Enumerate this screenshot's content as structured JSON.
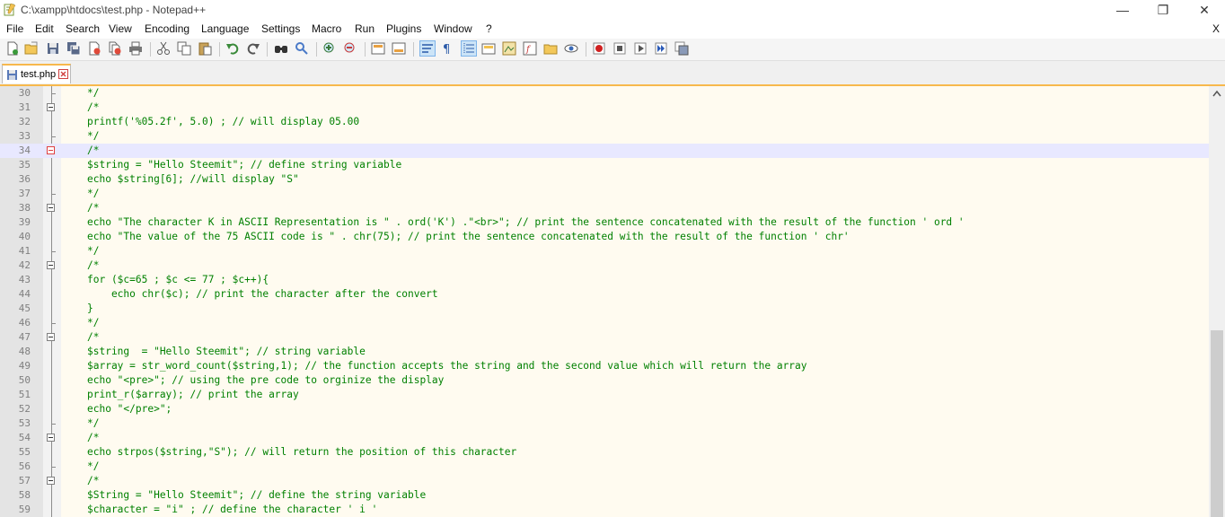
{
  "window": {
    "title": "C:\\xampp\\htdocs\\test.php - Notepad++",
    "minimize": "—",
    "restore": "❐",
    "close": "✕"
  },
  "menu": {
    "items": [
      "File",
      "Edit",
      "Search",
      "View",
      "Encoding",
      "Language",
      "Settings",
      "Macro",
      "Run",
      "Plugins",
      "Window",
      "?"
    ],
    "close_label": "X"
  },
  "toolbar": {
    "icons": [
      "new-file-icon",
      "open-file-icon",
      "save-icon",
      "save-all-icon",
      "close-icon",
      "close-all-icon",
      "print-icon",
      "cut-icon",
      "copy-icon",
      "paste-icon",
      "undo-icon",
      "redo-icon",
      "find-icon",
      "replace-icon",
      "zoom-in-icon",
      "zoom-out-icon",
      "sync-vertical-icon",
      "sync-horizontal-icon",
      "word-wrap-icon",
      "show-all-characters-icon",
      "indent-guide-icon",
      "user-language-icon",
      "document-map-icon",
      "function-list-icon",
      "folder-workspace-icon",
      "monitoring-icon",
      "record-macro-icon",
      "stop-macro-icon",
      "play-macro-icon",
      "run-macro-multiple-icon",
      "save-macro-icon"
    ]
  },
  "tabs": [
    {
      "label": "test.php"
    }
  ],
  "editor": {
    "lines": [
      {
        "n": "30",
        "code": "*/",
        "fold": "end"
      },
      {
        "n": "31",
        "code": "/*",
        "fold": "box"
      },
      {
        "n": "32",
        "code": "printf('%05.2f', 5.0) ; // will display 05.00",
        "fold": ""
      },
      {
        "n": "33",
        "code": "*/",
        "fold": "end"
      },
      {
        "n": "34",
        "code": "/*",
        "fold": "box-red",
        "current": true
      },
      {
        "n": "35",
        "code": "$string = \"Hello Steemit\"; // define string variable",
        "fold": ""
      },
      {
        "n": "36",
        "code": "echo $string[6]; //will display \"S\"",
        "fold": ""
      },
      {
        "n": "37",
        "code": "*/",
        "fold": "end"
      },
      {
        "n": "38",
        "code": "/*",
        "fold": "box"
      },
      {
        "n": "39",
        "code": "echo \"The character K in ASCII Representation is \" . ord('K') .\"<br>\"; // print the sentence concatenated with the result of the function ' ord '",
        "fold": ""
      },
      {
        "n": "40",
        "code": "echo \"The value of the 75 ASCII code is \" . chr(75); // print the sentence concatenated with the result of the function ' chr'",
        "fold": ""
      },
      {
        "n": "41",
        "code": "*/",
        "fold": "end"
      },
      {
        "n": "42",
        "code": "/*",
        "fold": "box"
      },
      {
        "n": "43",
        "code": "for ($c=65 ; $c <= 77 ; $c++){",
        "fold": ""
      },
      {
        "n": "44",
        "code": "    echo chr($c); // print the character after the convert",
        "fold": ""
      },
      {
        "n": "45",
        "code": "}",
        "fold": ""
      },
      {
        "n": "46",
        "code": "*/",
        "fold": "end"
      },
      {
        "n": "47",
        "code": "/*",
        "fold": "box"
      },
      {
        "n": "48",
        "code": "$string  = \"Hello Steemit\"; // string variable",
        "fold": ""
      },
      {
        "n": "49",
        "code": "$array = str_word_count($string,1); // the function accepts the string and the second value which will return the array",
        "fold": ""
      },
      {
        "n": "50",
        "code": "echo \"<pre>\"; // using the pre code to orginize the display",
        "fold": ""
      },
      {
        "n": "51",
        "code": "print_r($array); // print the array",
        "fold": ""
      },
      {
        "n": "52",
        "code": "echo \"</pre>\";",
        "fold": ""
      },
      {
        "n": "53",
        "code": "*/",
        "fold": "end"
      },
      {
        "n": "54",
        "code": "/*",
        "fold": "box"
      },
      {
        "n": "55",
        "code": "echo strpos($string,\"S\"); // will return the position of this character",
        "fold": ""
      },
      {
        "n": "56",
        "code": "*/",
        "fold": "end"
      },
      {
        "n": "57",
        "code": "/*",
        "fold": "box"
      },
      {
        "n": "58",
        "code": "$String = \"Hello Steemit\"; // define the string variable",
        "fold": ""
      },
      {
        "n": "59",
        "code": "$character = \"i\" ; // define the character ' i '",
        "fold": ""
      }
    ]
  }
}
